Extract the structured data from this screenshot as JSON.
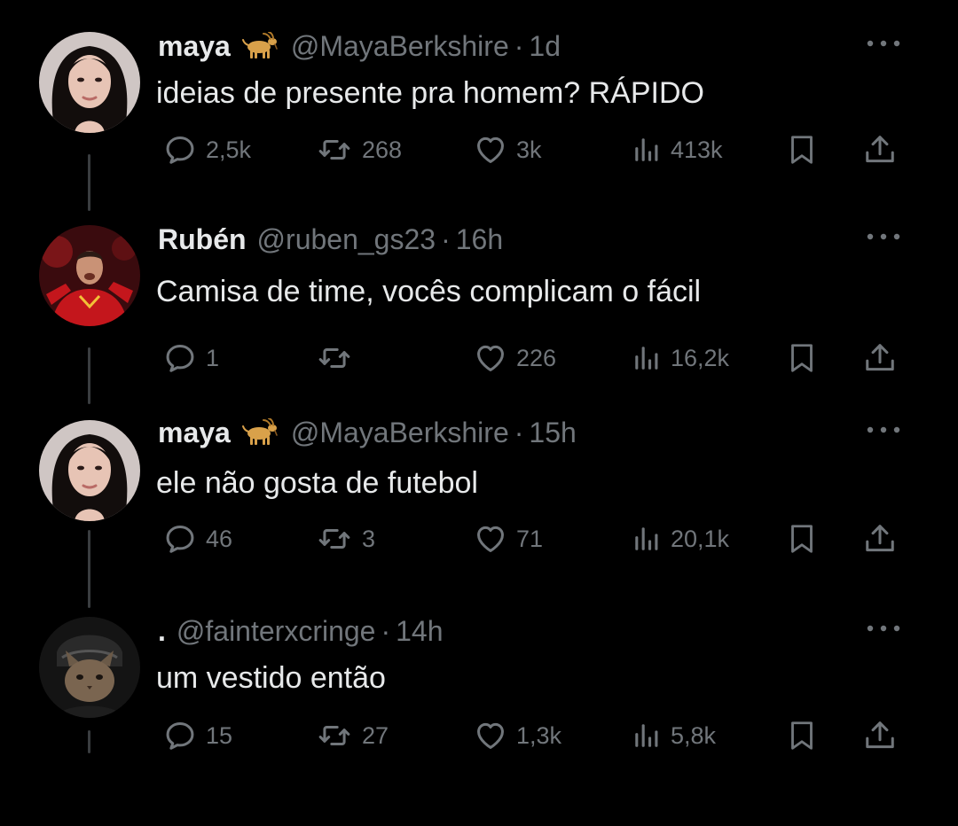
{
  "thread": {
    "tweets": [
      {
        "name": "maya",
        "handle": "@MayaBerkshire",
        "separator": "·",
        "time": "1d",
        "text": "ideias de presente pra homem? RÁPIDO",
        "badge_icon": "goat-emoji-icon",
        "avatar_icon": "profile-photo-woman-icon",
        "replies": "2,5k",
        "retweets": "268",
        "likes": "3k",
        "views": "413k"
      },
      {
        "name": "Rubén",
        "handle": "@ruben_gs23",
        "separator": "·",
        "time": "16h",
        "text": "Camisa de time, vocês complicam o fácil",
        "avatar_icon": "profile-photo-football-player-icon",
        "replies": "1",
        "retweets": "",
        "likes": "226",
        "views": "16,2k"
      },
      {
        "name": "maya",
        "handle": "@MayaBerkshire",
        "separator": "·",
        "time": "15h",
        "text": "ele não gosta de futebol",
        "badge_icon": "goat-emoji-icon",
        "avatar_icon": "profile-photo-woman-icon",
        "replies": "46",
        "retweets": "3",
        "likes": "71",
        "views": "20,1k"
      },
      {
        "name": ".",
        "handle": "@fainterxcringe",
        "separator": "·",
        "time": "14h",
        "text": "um vestido então",
        "avatar_icon": "profile-photo-cat-icon",
        "replies": "15",
        "retweets": "27",
        "likes": "1,3k",
        "views": "5,8k"
      }
    ]
  },
  "colors": {
    "background": "#000000",
    "text": "#e7e9ea",
    "secondary": "#71767b",
    "thread_line": "#3a3d40"
  }
}
